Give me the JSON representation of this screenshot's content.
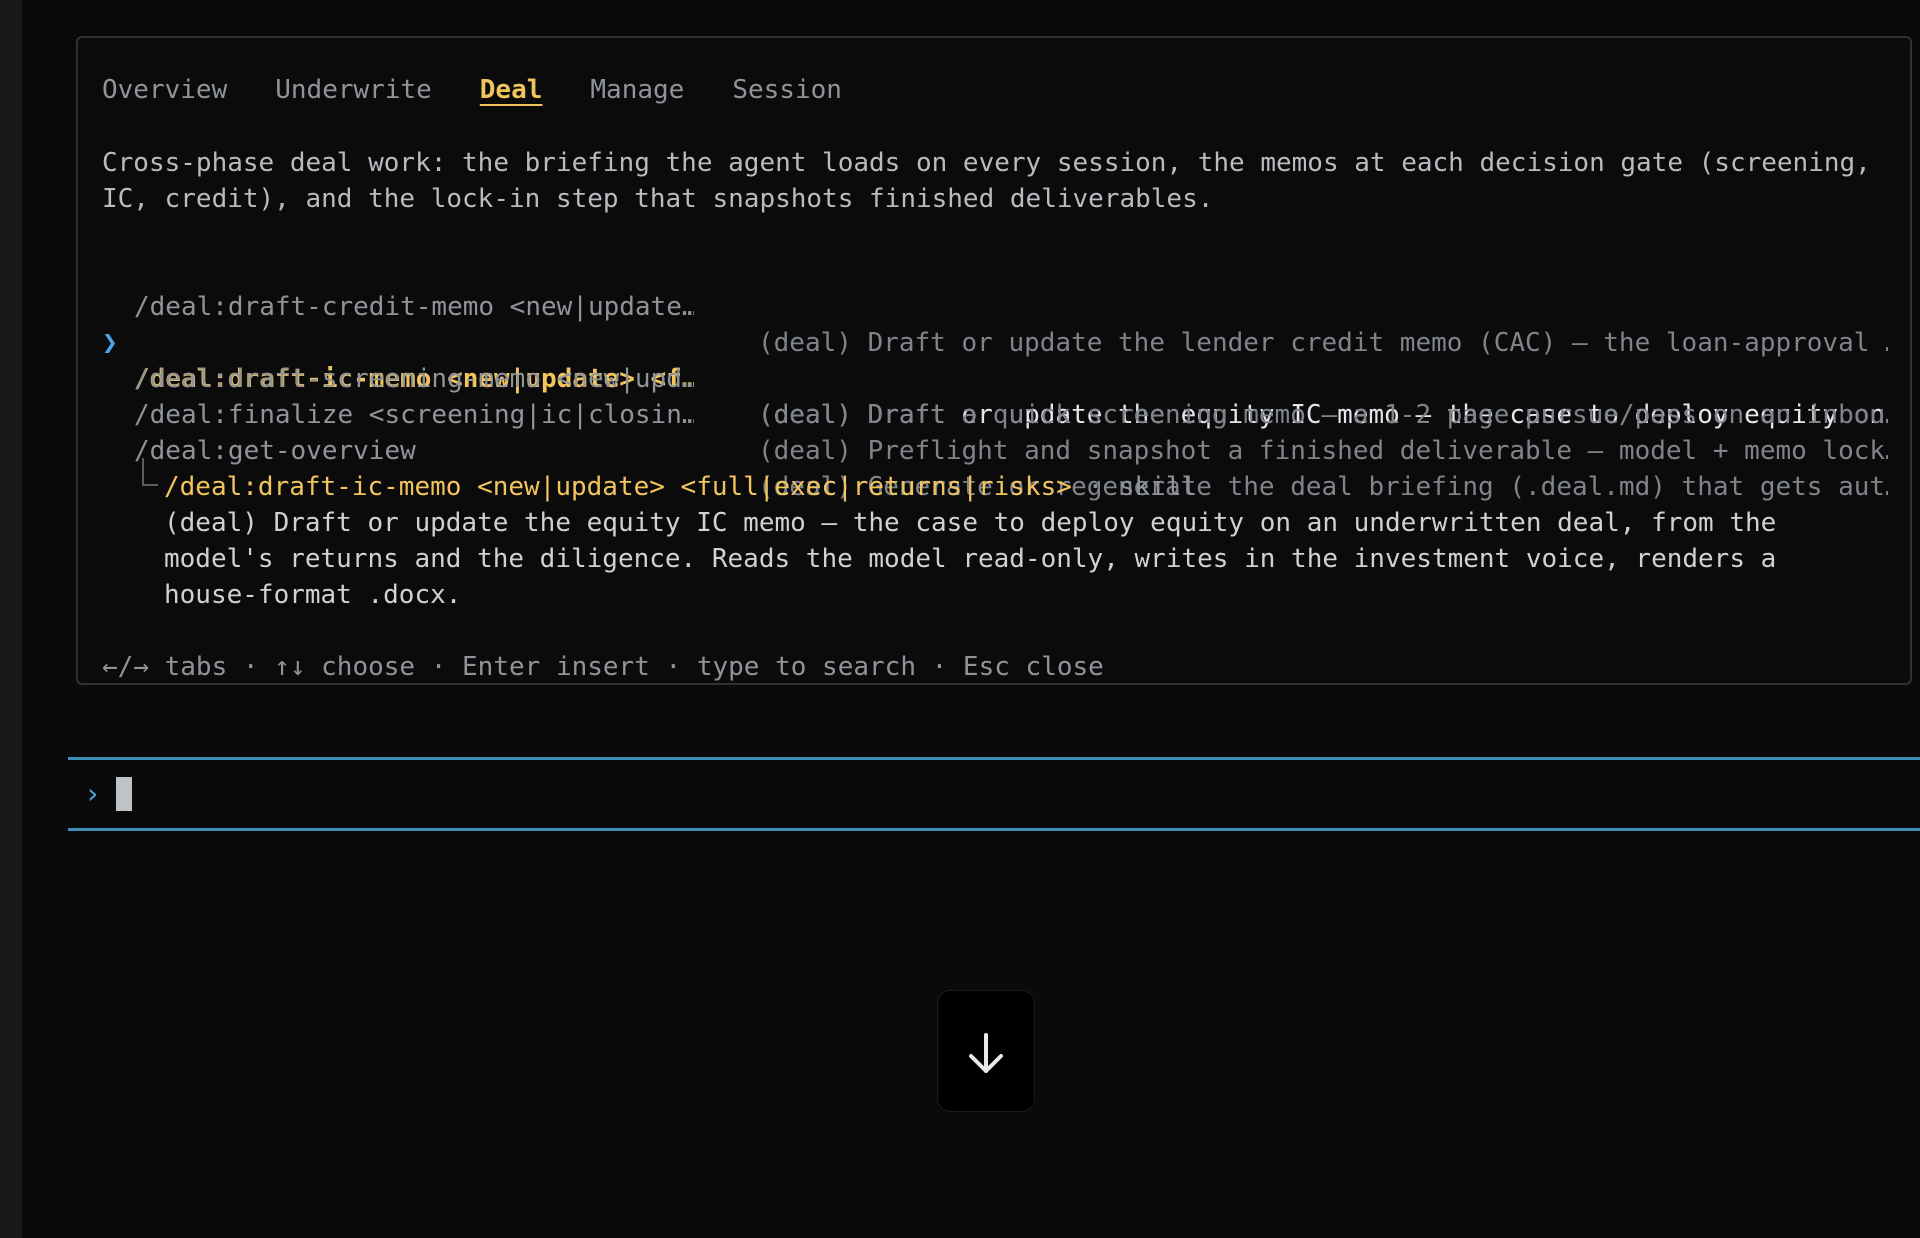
{
  "tabs": [
    {
      "label": "Overview",
      "active": false
    },
    {
      "label": "Underwrite",
      "active": false
    },
    {
      "label": "Deal",
      "active": true
    },
    {
      "label": "Manage",
      "active": false
    },
    {
      "label": "Session",
      "active": false
    }
  ],
  "description": {
    "line1": "Cross-phase deal work: the briefing the agent loads on every session, the memos at each decision gate (screening,",
    "line2": "IC, credit), and the lock-in step that snapshots finished deliverables."
  },
  "commands": [
    {
      "name": "/deal:draft-credit-memo <new|update…",
      "text": "(deal) Draft or update the lender credit memo (CAC) — the loan-approval …",
      "selected": false
    },
    {
      "name": "/deal:draft-ic-memo <new|update> <f…",
      "text": "(deal) Draft or update the equity IC memo — the case to deploy equity on…",
      "selected": true
    },
    {
      "name": "/deal:draft-screening-memo <new|upd…",
      "text": "(deal) Draft a quick screening memo — a 1-2 page pursue/pass on an inbou…",
      "selected": false
    },
    {
      "name": "/deal:finalize <screening|ic|closin…",
      "text": "(deal) Preflight and snapshot a finished deliverable — model + memo lock…",
      "selected": false
    },
    {
      "name": "/deal:get-overview",
      "text": "(deal) Generate or regenerate the deal briefing (.deal.md) that gets aut…",
      "selected": false
    }
  ],
  "selection_marker": "❯",
  "detail": {
    "name": "/deal:draft-ic-memo <new|update> <full|exec|returns|risks>",
    "tag": " · skill",
    "body_line1": "(deal) Draft or update the equity IC memo — the case to deploy equity on an underwritten deal, from the",
    "body_line2": "model's returns and the diligence. Reads the model read-only, writes in the investment voice, renders a",
    "body_line3": "house-format .docx."
  },
  "hint": "←/→ tabs · ↑↓ choose · Enter insert · type to search · Esc close",
  "prompt": {
    "chevron": "›",
    "value": ""
  },
  "icons": {
    "scroll_down": "arrow-down-icon"
  },
  "colors": {
    "accent_yellow": "#f2c55c",
    "accent_blue": "#4aa6e8",
    "input_border": "#3d8fb8"
  }
}
